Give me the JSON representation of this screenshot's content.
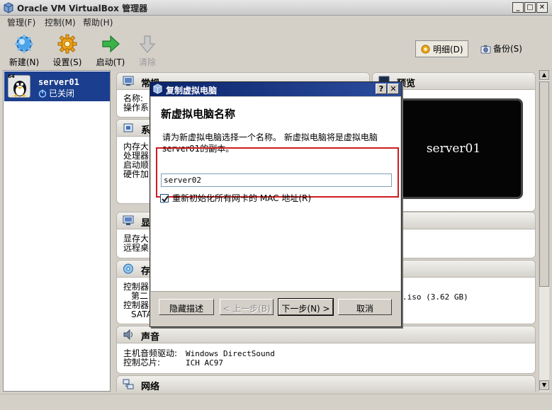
{
  "window": {
    "title": "Oracle VM VirtualBox 管理器",
    "minimize": "_",
    "maximize": "□",
    "close": "✕"
  },
  "menu": {
    "items": [
      "管理(F)",
      "控制(M)",
      "帮助(H)"
    ]
  },
  "toolbar": {
    "new_label": "新建(N)",
    "settings_label": "设置(S)",
    "start_label": "启动(T)",
    "discard_label": "清除",
    "details_label": "明细(D)",
    "snapshots_label": "备份(S)"
  },
  "vm_list": {
    "items": [
      {
        "name": "server01",
        "state": "已关闭",
        "os_badge": "64"
      }
    ]
  },
  "details": {
    "general": {
      "title": "常规",
      "rows": [
        "名称:",
        "操作系"
      ]
    },
    "system": {
      "title": "系",
      "rows": [
        "内存大",
        "处理器",
        "启动顺",
        "硬件加"
      ]
    },
    "preview": {
      "title": "预览",
      "screen_text": "server01"
    },
    "display": {
      "title": "显",
      "rows": [
        "显存大",
        "远程桌"
      ]
    },
    "storage": {
      "title": "存",
      "rows": [
        "控制器",
        "第二",
        "控制器",
        "SATA"
      ],
      "iso_text": ".iso (3.62 GB)"
    },
    "audio": {
      "title": "声音",
      "rows": [
        {
          "key": "主机音频驱动:",
          "value": "Windows DirectSound"
        },
        {
          "key": "控制芯片:",
          "value": "ICH AC97"
        }
      ]
    },
    "network": {
      "title": "网络"
    }
  },
  "scrollbar": {
    "up": "▲",
    "down": "▼"
  },
  "dialog": {
    "title": "复制虚拟电脑",
    "help_button": "?",
    "close_button": "✕",
    "heading": "新虚拟电脑名称",
    "description": "请为新虚拟电脑选择一个名称。 新虚拟电脑将是虚拟电脑 server01的副本。",
    "name_value": "server02",
    "reinit_mac_label": "重新初始化所有网卡的 MAC 地址(R)",
    "reinit_mac_checked": true,
    "buttons": {
      "hide_description": "隐藏描述",
      "back": "< 上一步(B)",
      "next": "下一步(N) >",
      "cancel": "取消"
    }
  },
  "colors": {
    "selection": "#1b3f8e",
    "dialog_title": "#0a246a",
    "highlight_border": "#cc1d1d"
  }
}
